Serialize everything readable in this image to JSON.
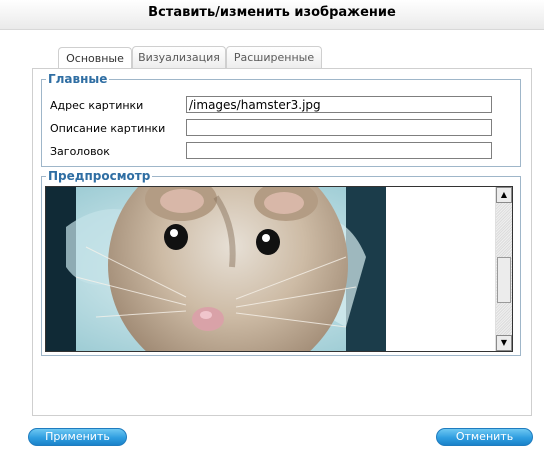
{
  "dialog": {
    "title": "Вставить/изменить изображение"
  },
  "tabs": [
    {
      "label": "Основные",
      "active": true
    },
    {
      "label": "Визуализация",
      "active": false
    },
    {
      "label": "Расширенные",
      "active": false
    }
  ],
  "general": {
    "legend": "Главные",
    "image_url_label": "Адрес картинки",
    "image_url_value": "/images/hamster3.jpg",
    "description_label": "Описание картинки",
    "description_value": "",
    "title_label": "Заголовок",
    "title_value": ""
  },
  "preview": {
    "legend": "Предпросмотр",
    "scroll_up_icon": "▲",
    "scroll_down_icon": "▼"
  },
  "buttons": {
    "insert": "Применить",
    "cancel": "Отменить"
  },
  "colors": {
    "accent": "#2f6ea3",
    "button": "#2f9ee0"
  }
}
